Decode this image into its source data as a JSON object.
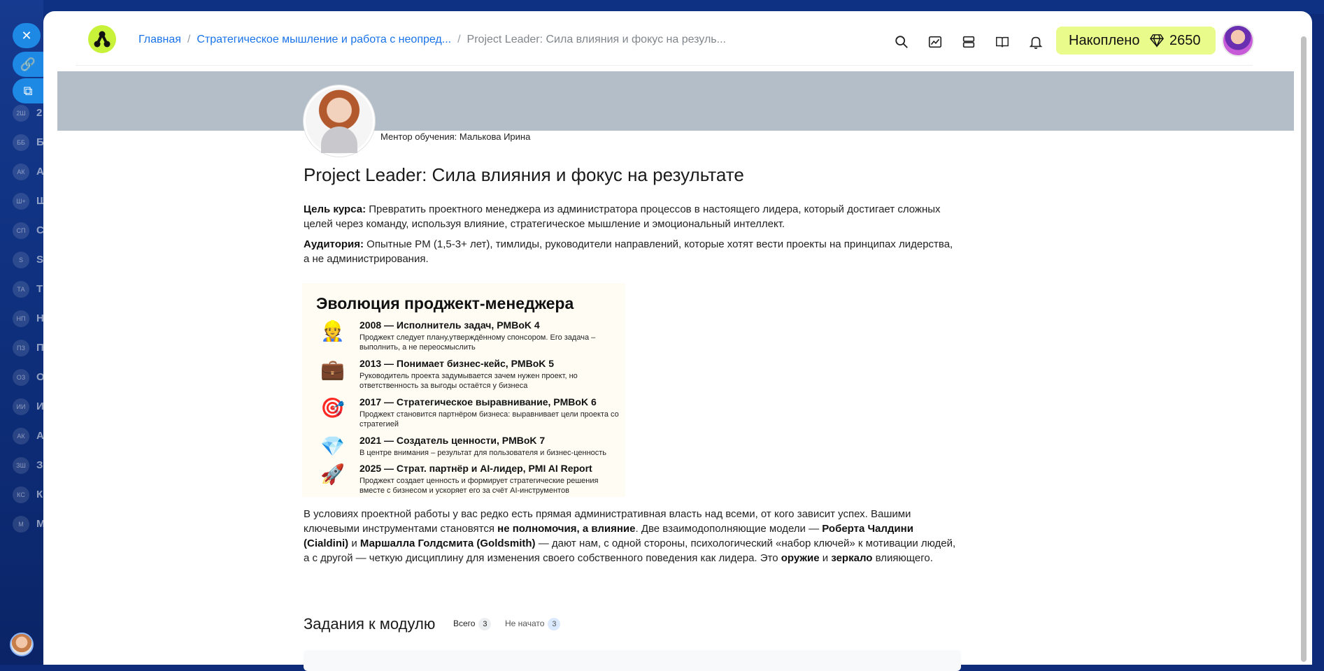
{
  "header": {
    "breadcrumb": {
      "home": "Главная",
      "course": "Стратегическое мышление и работа с неопред...",
      "current": "Project Leader: Сила влияния и фокус на резуль..."
    },
    "accumulated": {
      "label": "Накоплено",
      "value": "2650",
      "icon": "diamond-icon"
    },
    "icons": [
      "search-icon",
      "chart-icon",
      "layers-icon",
      "book-icon",
      "bell-icon"
    ]
  },
  "mentor": {
    "label": "Ментор обучения: Малькова Ирина"
  },
  "page": {
    "title": "Project Leader: Сила влияния и фокус на результате",
    "goal_label": "Цель курса:",
    "goal_text": " Превратить проектного менеджера из администратора процессов в настоящего лидера, который достигает сложных целей через команду, используя влияние, стратегическое мышление и эмоциональный интеллект.",
    "audience_label": "Аудитория:",
    "audience_text": " Опытные PM (1,5-3+ лет), тимлиды, руководители направлений, которые хотят вести проекты на принципах лидерства, а не администрирования.",
    "body": {
      "t1": "В условиях проектной работы у вас редко есть прямая административная власть над всеми, от кого зависит успех. Вашими ключевыми инструментами становятся ",
      "b1": "не полномочия, а влияние",
      "t2": ". Две взаимодополняющие модели — ",
      "b2": "Роберта Чалдини (Cialdini)",
      "t3": " и ",
      "b3": "Маршалла Голдсмита (Goldsmith)",
      "t4": " — дают нам, с одной стороны, психологический «набор ключей» к мотивации людей, а с другой — четкую дисциплину для изменения своего собственного поведения как лидера. Это ",
      "b4": "оружие",
      "t5": " и ",
      "b5": "зеркало",
      "t6": " влияющего."
    }
  },
  "infographic": {
    "title": "Эволюция проджект-менеджера",
    "items": [
      {
        "emoji": "👷",
        "heading": "2008 — Исполнитель задач, PMBoK 4",
        "desc": "Проджект следует плану,утверждённому  спонсором. Его задача – выполнить, а не переосмыслить"
      },
      {
        "emoji": "💼",
        "heading": "2013 — Понимает бизнес-кейс, PMBoK 5",
        "desc": "Руководитель проекта задумывается зачем нужен проект, но ответственность за выгоды остаётся у бизнеса"
      },
      {
        "emoji": "🎯",
        "heading": "2017 — Стратегическое выравнивание, PMBoK 6",
        "desc": "Проджект становится партнёром бизнеса: выравнивает цели проекта со стратегией"
      },
      {
        "emoji": "💎",
        "heading": "2021 — Создатель ценности, PMBoK 7",
        "desc": "В центре внимания – результат для пользователя и бизнес-ценность"
      },
      {
        "emoji": "🚀",
        "heading": "2025 — Страт. партнёр и AI-лидер, PMI AI Report",
        "desc": "Проджект создает ценность и формирует стратегические решения вместе с бизнесом и ускоряет его за счёт AI-инструментов"
      }
    ]
  },
  "tasks": {
    "title": "Задания к модулю",
    "tab_all": "Всего",
    "tab_all_count": "3",
    "tab_not_started": "Не начато",
    "tab_not_started_count": "3"
  },
  "background": {
    "sidebar_initials": [
      "2Ш",
      "ББ",
      "АК",
      "Ш+",
      "СП",
      "S",
      "ТА",
      "НП",
      "ПЗ",
      "ОЗ",
      "ИИ",
      "АК",
      "ЗШ",
      "КС",
      "М"
    ],
    "sidebar_labels": [
      "2",
      "Б",
      "А",
      "Ш",
      "С",
      "S",
      "Т",
      "Н",
      "П",
      "О",
      "И",
      "А",
      "З",
      "К",
      "М"
    ]
  }
}
